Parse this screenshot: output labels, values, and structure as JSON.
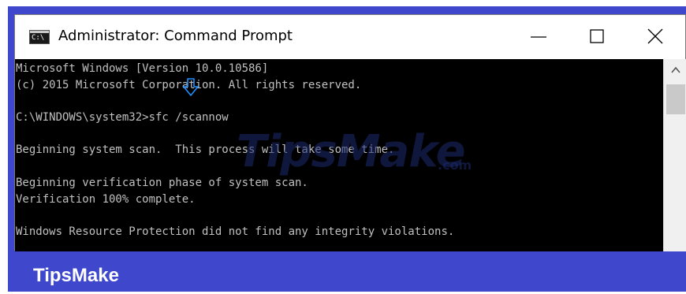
{
  "window": {
    "title": "Administrator: Command Prompt",
    "app_icon": "cmd-icon",
    "app_icon_text": "C:\\",
    "controls": {
      "minimize": "minimize-icon",
      "maximize": "maximize-icon",
      "close": "close-icon"
    }
  },
  "console": {
    "lines": [
      "Microsoft Windows [Version 10.0.10586]",
      "(c) 2015 Microsoft Corporation. All rights reserved.",
      "",
      "C:\\WINDOWS\\system32>sfc /scannow",
      "",
      "Beginning system scan.  This process will take some time.",
      "",
      "Beginning verification phase of system scan.",
      "Verification 100% complete.",
      "",
      "Windows Resource Protection did not find any integrity violations."
    ],
    "text_color": "#c0c0c0",
    "background": "#000000"
  },
  "annotation": {
    "arrow": "down-arrow-icon",
    "color": "#1e90ff"
  },
  "watermark": {
    "main": "TipsMake",
    "sub": ".com"
  },
  "brand": {
    "label": "TipsMake",
    "frame_color": "#3f48cc"
  }
}
